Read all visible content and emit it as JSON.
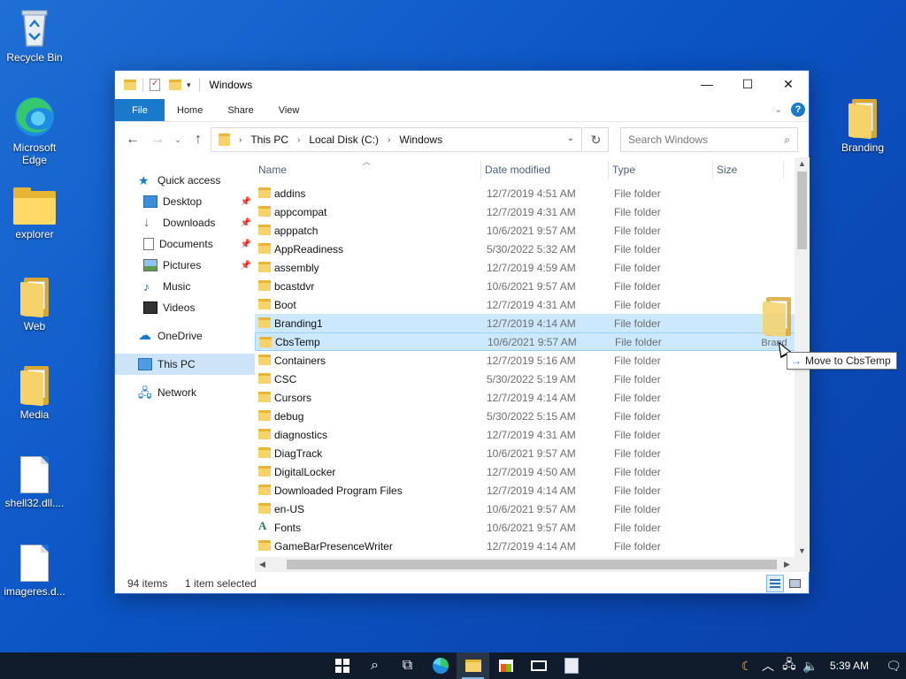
{
  "desktop": {
    "icons": [
      {
        "label": "Recycle Bin",
        "icon": "recycle-bin-icon"
      },
      {
        "label": "Microsoft Edge",
        "icon": "edge-icon"
      },
      {
        "label": "explorer",
        "icon": "folder-icon"
      },
      {
        "label": "Web",
        "icon": "folder-icon"
      },
      {
        "label": "Media",
        "icon": "folder-icon"
      },
      {
        "label": "shell32.dll....",
        "icon": "document-icon"
      },
      {
        "label": "imageres.d...",
        "icon": "document-icon"
      },
      {
        "label": "Branding",
        "icon": "folder-icon"
      }
    ]
  },
  "window": {
    "title": "Windows",
    "controls": {
      "minimize": "—",
      "maximize": "☐",
      "close": "✕"
    },
    "ribbon_tabs": [
      "File",
      "Home",
      "Share",
      "View"
    ],
    "help": "?",
    "breadcrumbs": [
      "This PC",
      "Local Disk (C:)",
      "Windows"
    ],
    "search_placeholder": "Search Windows",
    "nav": {
      "quick_access": "Quick access",
      "quick_items": [
        "Desktop",
        "Downloads",
        "Documents",
        "Pictures",
        "Music",
        "Videos"
      ],
      "onedrive": "OneDrive",
      "this_pc": "This PC",
      "network": "Network"
    },
    "columns": {
      "name": "Name",
      "date": "Date modified",
      "type": "Type",
      "size": "Size"
    },
    "files": [
      {
        "name": "addins",
        "date": "12/7/2019 4:51 AM",
        "type": "File folder"
      },
      {
        "name": "appcompat",
        "date": "12/7/2019 4:31 AM",
        "type": "File folder"
      },
      {
        "name": "apppatch",
        "date": "10/6/2021 9:57 AM",
        "type": "File folder"
      },
      {
        "name": "AppReadiness",
        "date": "5/30/2022 5:32 AM",
        "type": "File folder"
      },
      {
        "name": "assembly",
        "date": "12/7/2019 4:59 AM",
        "type": "File folder"
      },
      {
        "name": "bcastdvr",
        "date": "10/6/2021 9:57 AM",
        "type": "File folder"
      },
      {
        "name": "Boot",
        "date": "12/7/2019 4:31 AM",
        "type": "File folder"
      },
      {
        "name": "Branding1",
        "date": "12/7/2019 4:14 AM",
        "type": "File folder"
      },
      {
        "name": "CbsTemp",
        "date": "10/6/2021 9:57 AM",
        "type": "File folder"
      },
      {
        "name": "Containers",
        "date": "12/7/2019 5:16 AM",
        "type": "File folder"
      },
      {
        "name": "CSC",
        "date": "5/30/2022 5:19 AM",
        "type": "File folder"
      },
      {
        "name": "Cursors",
        "date": "12/7/2019 4:14 AM",
        "type": "File folder"
      },
      {
        "name": "debug",
        "date": "5/30/2022 5:15 AM",
        "type": "File folder"
      },
      {
        "name": "diagnostics",
        "date": "12/7/2019 4:31 AM",
        "type": "File folder"
      },
      {
        "name": "DiagTrack",
        "date": "10/6/2021 9:57 AM",
        "type": "File folder"
      },
      {
        "name": "DigitalLocker",
        "date": "12/7/2019 4:50 AM",
        "type": "File folder"
      },
      {
        "name": "Downloaded Program Files",
        "date": "12/7/2019 4:14 AM",
        "type": "File folder"
      },
      {
        "name": "en-US",
        "date": "10/6/2021 9:57 AM",
        "type": "File folder"
      },
      {
        "name": "Fonts",
        "date": "10/6/2021 9:57 AM",
        "type": "File folder"
      },
      {
        "name": "GameBarPresenceWriter",
        "date": "12/7/2019 4:14 AM",
        "type": "File folder"
      }
    ],
    "status": {
      "count": "94 items",
      "selected": "1 item selected"
    }
  },
  "drag": {
    "ghost_label": "Brand",
    "tooltip": "Move to CbsTemp"
  },
  "taskbar": {
    "time": "5:39 AM"
  },
  "colors": {
    "accent": "#1979ca",
    "selection": "#cce8ff",
    "taskbar": "#101c2c",
    "desktop": "#0b54c4"
  }
}
